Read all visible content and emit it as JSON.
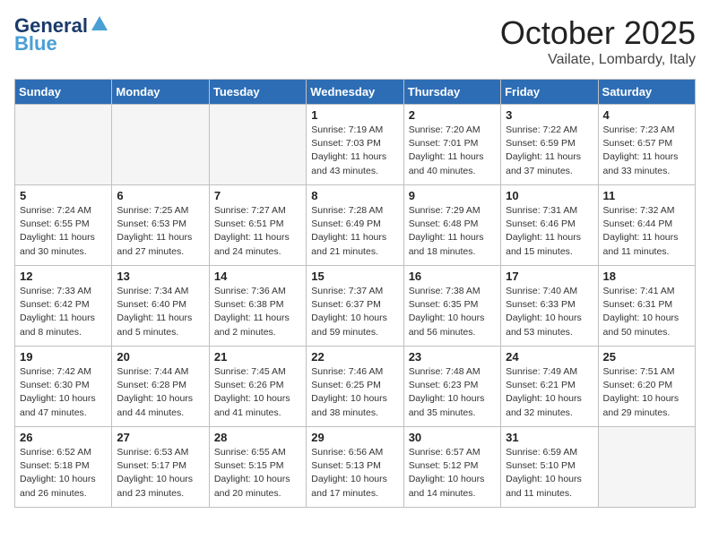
{
  "header": {
    "logo_general": "General",
    "logo_blue": "Blue",
    "month_title": "October 2025",
    "location": "Vailate, Lombardy, Italy"
  },
  "days_of_week": [
    "Sunday",
    "Monday",
    "Tuesday",
    "Wednesday",
    "Thursday",
    "Friday",
    "Saturday"
  ],
  "weeks": [
    {
      "shade": false,
      "days": [
        {
          "num": "",
          "empty": true
        },
        {
          "num": "",
          "empty": true
        },
        {
          "num": "",
          "empty": true
        },
        {
          "num": "1",
          "sunrise": "Sunrise: 7:19 AM",
          "sunset": "Sunset: 7:03 PM",
          "daylight": "Daylight: 11 hours and 43 minutes."
        },
        {
          "num": "2",
          "sunrise": "Sunrise: 7:20 AM",
          "sunset": "Sunset: 7:01 PM",
          "daylight": "Daylight: 11 hours and 40 minutes."
        },
        {
          "num": "3",
          "sunrise": "Sunrise: 7:22 AM",
          "sunset": "Sunset: 6:59 PM",
          "daylight": "Daylight: 11 hours and 37 minutes."
        },
        {
          "num": "4",
          "sunrise": "Sunrise: 7:23 AM",
          "sunset": "Sunset: 6:57 PM",
          "daylight": "Daylight: 11 hours and 33 minutes."
        }
      ]
    },
    {
      "shade": true,
      "days": [
        {
          "num": "5",
          "sunrise": "Sunrise: 7:24 AM",
          "sunset": "Sunset: 6:55 PM",
          "daylight": "Daylight: 11 hours and 30 minutes."
        },
        {
          "num": "6",
          "sunrise": "Sunrise: 7:25 AM",
          "sunset": "Sunset: 6:53 PM",
          "daylight": "Daylight: 11 hours and 27 minutes."
        },
        {
          "num": "7",
          "sunrise": "Sunrise: 7:27 AM",
          "sunset": "Sunset: 6:51 PM",
          "daylight": "Daylight: 11 hours and 24 minutes."
        },
        {
          "num": "8",
          "sunrise": "Sunrise: 7:28 AM",
          "sunset": "Sunset: 6:49 PM",
          "daylight": "Daylight: 11 hours and 21 minutes."
        },
        {
          "num": "9",
          "sunrise": "Sunrise: 7:29 AM",
          "sunset": "Sunset: 6:48 PM",
          "daylight": "Daylight: 11 hours and 18 minutes."
        },
        {
          "num": "10",
          "sunrise": "Sunrise: 7:31 AM",
          "sunset": "Sunset: 6:46 PM",
          "daylight": "Daylight: 11 hours and 15 minutes."
        },
        {
          "num": "11",
          "sunrise": "Sunrise: 7:32 AM",
          "sunset": "Sunset: 6:44 PM",
          "daylight": "Daylight: 11 hours and 11 minutes."
        }
      ]
    },
    {
      "shade": false,
      "days": [
        {
          "num": "12",
          "sunrise": "Sunrise: 7:33 AM",
          "sunset": "Sunset: 6:42 PM",
          "daylight": "Daylight: 11 hours and 8 minutes."
        },
        {
          "num": "13",
          "sunrise": "Sunrise: 7:34 AM",
          "sunset": "Sunset: 6:40 PM",
          "daylight": "Daylight: 11 hours and 5 minutes."
        },
        {
          "num": "14",
          "sunrise": "Sunrise: 7:36 AM",
          "sunset": "Sunset: 6:38 PM",
          "daylight": "Daylight: 11 hours and 2 minutes."
        },
        {
          "num": "15",
          "sunrise": "Sunrise: 7:37 AM",
          "sunset": "Sunset: 6:37 PM",
          "daylight": "Daylight: 10 hours and 59 minutes."
        },
        {
          "num": "16",
          "sunrise": "Sunrise: 7:38 AM",
          "sunset": "Sunset: 6:35 PM",
          "daylight": "Daylight: 10 hours and 56 minutes."
        },
        {
          "num": "17",
          "sunrise": "Sunrise: 7:40 AM",
          "sunset": "Sunset: 6:33 PM",
          "daylight": "Daylight: 10 hours and 53 minutes."
        },
        {
          "num": "18",
          "sunrise": "Sunrise: 7:41 AM",
          "sunset": "Sunset: 6:31 PM",
          "daylight": "Daylight: 10 hours and 50 minutes."
        }
      ]
    },
    {
      "shade": true,
      "days": [
        {
          "num": "19",
          "sunrise": "Sunrise: 7:42 AM",
          "sunset": "Sunset: 6:30 PM",
          "daylight": "Daylight: 10 hours and 47 minutes."
        },
        {
          "num": "20",
          "sunrise": "Sunrise: 7:44 AM",
          "sunset": "Sunset: 6:28 PM",
          "daylight": "Daylight: 10 hours and 44 minutes."
        },
        {
          "num": "21",
          "sunrise": "Sunrise: 7:45 AM",
          "sunset": "Sunset: 6:26 PM",
          "daylight": "Daylight: 10 hours and 41 minutes."
        },
        {
          "num": "22",
          "sunrise": "Sunrise: 7:46 AM",
          "sunset": "Sunset: 6:25 PM",
          "daylight": "Daylight: 10 hours and 38 minutes."
        },
        {
          "num": "23",
          "sunrise": "Sunrise: 7:48 AM",
          "sunset": "Sunset: 6:23 PM",
          "daylight": "Daylight: 10 hours and 35 minutes."
        },
        {
          "num": "24",
          "sunrise": "Sunrise: 7:49 AM",
          "sunset": "Sunset: 6:21 PM",
          "daylight": "Daylight: 10 hours and 32 minutes."
        },
        {
          "num": "25",
          "sunrise": "Sunrise: 7:51 AM",
          "sunset": "Sunset: 6:20 PM",
          "daylight": "Daylight: 10 hours and 29 minutes."
        }
      ]
    },
    {
      "shade": false,
      "days": [
        {
          "num": "26",
          "sunrise": "Sunrise: 6:52 AM",
          "sunset": "Sunset: 5:18 PM",
          "daylight": "Daylight: 10 hours and 26 minutes."
        },
        {
          "num": "27",
          "sunrise": "Sunrise: 6:53 AM",
          "sunset": "Sunset: 5:17 PM",
          "daylight": "Daylight: 10 hours and 23 minutes."
        },
        {
          "num": "28",
          "sunrise": "Sunrise: 6:55 AM",
          "sunset": "Sunset: 5:15 PM",
          "daylight": "Daylight: 10 hours and 20 minutes."
        },
        {
          "num": "29",
          "sunrise": "Sunrise: 6:56 AM",
          "sunset": "Sunset: 5:13 PM",
          "daylight": "Daylight: 10 hours and 17 minutes."
        },
        {
          "num": "30",
          "sunrise": "Sunrise: 6:57 AM",
          "sunset": "Sunset: 5:12 PM",
          "daylight": "Daylight: 10 hours and 14 minutes."
        },
        {
          "num": "31",
          "sunrise": "Sunrise: 6:59 AM",
          "sunset": "Sunset: 5:10 PM",
          "daylight": "Daylight: 10 hours and 11 minutes."
        },
        {
          "num": "",
          "empty": true
        }
      ]
    }
  ]
}
